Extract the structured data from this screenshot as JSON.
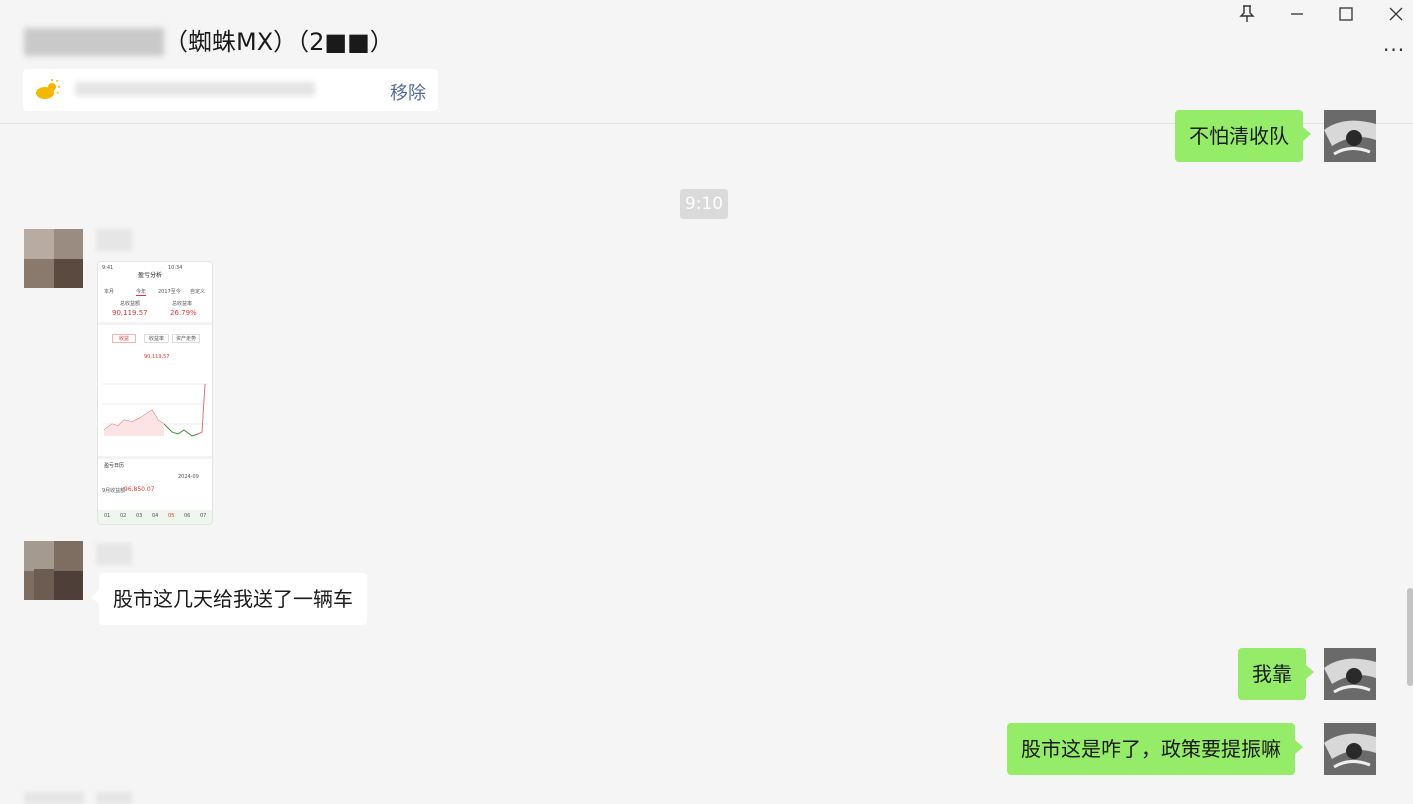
{
  "window": {
    "title_blurred_prefix": "■■■■■■",
    "title_suffix": "（蜘蛛MX）（2■■）",
    "controls": [
      "pin-icon",
      "minimize-icon",
      "maximize-icon",
      "close-icon"
    ],
    "more_label": "···"
  },
  "notice": {
    "icon": "weather-icon",
    "text_blurred": "■■■■■■■■■■■■■■■",
    "action_label": "移除"
  },
  "messages": [
    {
      "side": "right",
      "text": "不怕清收队"
    },
    {
      "side": "center",
      "timestamp": "9:10"
    },
    {
      "side": "left",
      "type": "image",
      "alt": "stock screenshot"
    },
    {
      "side": "left",
      "text": "股市这几天给我送了一辆车"
    },
    {
      "side": "right",
      "text": "我靠"
    },
    {
      "side": "right",
      "text": "股市这是咋了，政策要提振嘛"
    }
  ],
  "screenshot": {
    "header": "盈亏分析",
    "tabs": [
      "本月",
      "今年",
      "2017至今",
      "自定义"
    ],
    "stat1_label": "总收益额",
    "stat1_value": "90,119.57",
    "stat2_label": "总收益率",
    "stat2_value": "26.79%",
    "pills": [
      "收益",
      "收益率",
      "资产走势"
    ],
    "mid_value": "90,119.57",
    "section_title": "盈亏日历",
    "month": "2024-09",
    "month_profit_label": "9月收益额",
    "month_profit": "96,850.07",
    "days": [
      "01",
      "02",
      "03",
      "04",
      "05",
      "06",
      "07"
    ]
  },
  "colors": {
    "bubble_green": "#95ec69",
    "bg": "#f5f5f5",
    "accent_red": "#e53935",
    "accent_green": "#43a047"
  }
}
